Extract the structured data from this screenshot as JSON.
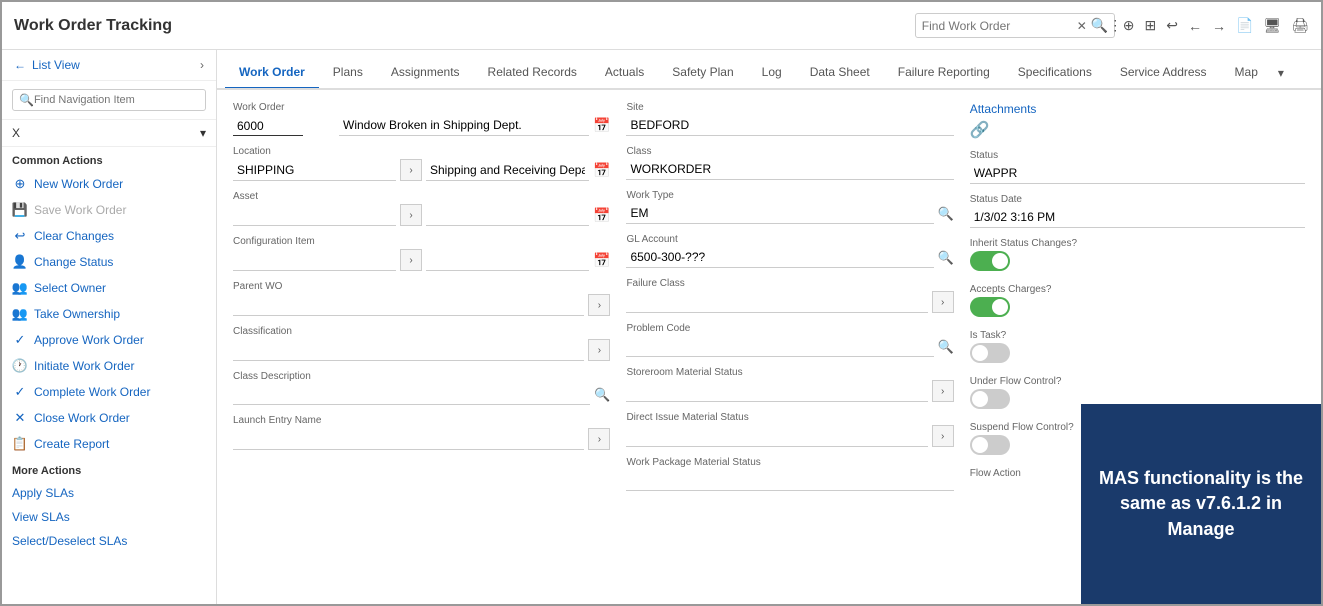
{
  "app": {
    "title": "Work Order Tracking",
    "search_placeholder": "Find Work Order"
  },
  "tabs": {
    "items": [
      {
        "label": "Work Order",
        "active": true
      },
      {
        "label": "Plans",
        "active": false
      },
      {
        "label": "Assignments",
        "active": false
      },
      {
        "label": "Related Records",
        "active": false
      },
      {
        "label": "Actuals",
        "active": false
      },
      {
        "label": "Safety Plan",
        "active": false
      },
      {
        "label": "Log",
        "active": false
      },
      {
        "label": "Data Sheet",
        "active": false
      },
      {
        "label": "Failure Reporting",
        "active": false
      },
      {
        "label": "Specifications",
        "active": false
      },
      {
        "label": "Service Address",
        "active": false
      },
      {
        "label": "Map",
        "active": false
      }
    ]
  },
  "sidebar": {
    "list_view": "List View",
    "search_placeholder": "Find Navigation Item",
    "dropdown_value": "X",
    "common_actions_label": "Common Actions",
    "actions": [
      {
        "label": "New Work Order",
        "icon": "+",
        "disabled": false,
        "name": "new-work-order"
      },
      {
        "label": "Save Work Order",
        "icon": "💾",
        "disabled": true,
        "name": "save-work-order"
      },
      {
        "label": "Clear Changes",
        "icon": "↩",
        "disabled": false,
        "name": "clear-changes"
      },
      {
        "label": "Change Status",
        "icon": "👤",
        "disabled": false,
        "name": "change-status"
      },
      {
        "label": "Select Owner",
        "icon": "👥",
        "disabled": false,
        "name": "select-owner"
      },
      {
        "label": "Take Ownership",
        "icon": "👥",
        "disabled": false,
        "name": "take-ownership"
      },
      {
        "label": "Approve Work Order",
        "icon": "✓",
        "disabled": false,
        "name": "approve-work-order"
      },
      {
        "label": "Initiate Work Order",
        "icon": "🕐",
        "disabled": false,
        "name": "initiate-work-order"
      },
      {
        "label": "Complete Work Order",
        "icon": "✓",
        "disabled": false,
        "name": "complete-work-order"
      },
      {
        "label": "Close Work Order",
        "icon": "✕",
        "disabled": false,
        "name": "close-work-order"
      },
      {
        "label": "Create Report",
        "icon": "📋",
        "disabled": false,
        "name": "create-report"
      }
    ],
    "more_actions_label": "More Actions",
    "more_actions": [
      {
        "label": "Apply SLAs",
        "name": "apply-slas"
      },
      {
        "label": "View SLAs",
        "name": "view-slas"
      },
      {
        "label": "Select/Deselect SLAs",
        "name": "select-deselect-slas"
      }
    ]
  },
  "form": {
    "work_order_label": "Work Order",
    "work_order_number": "6000",
    "work_order_desc": "Window Broken in Shipping Dept.",
    "location_label": "Location",
    "location_code": "SHIPPING",
    "location_desc": "Shipping and Receiving Department",
    "asset_label": "Asset",
    "asset_value": "",
    "config_item_label": "Configuration Item",
    "config_item_value": "",
    "parent_wo_label": "Parent WO",
    "parent_wo_value": "",
    "classification_label": "Classification",
    "classification_value": "",
    "class_desc_label": "Class Description",
    "class_desc_value": "",
    "launch_entry_label": "Launch Entry Name",
    "launch_entry_value": "",
    "site_label": "Site",
    "site_value": "BEDFORD",
    "class_label": "Class",
    "class_value": "WORKORDER",
    "work_type_label": "Work Type",
    "work_type_value": "EM",
    "gl_account_label": "GL Account",
    "gl_account_value": "6500-300-???",
    "failure_class_label": "Failure Class",
    "failure_class_value": "",
    "problem_code_label": "Problem Code",
    "problem_code_value": "",
    "storeroom_material_label": "Storeroom Material Status",
    "storeroom_material_value": "",
    "direct_issue_label": "Direct Issue Material Status",
    "direct_issue_value": "",
    "work_package_label": "Work Package Material Status",
    "work_package_value": "",
    "attachments_label": "Attachments",
    "status_label": "Status",
    "status_value": "WAPPR",
    "status_date_label": "Status Date",
    "status_date_value": "1/3/02 3:16 PM",
    "inherit_status_label": "Inherit Status Changes?",
    "inherit_status_on": true,
    "accepts_charges_label": "Accepts Charges?",
    "accepts_charges_on": true,
    "is_task_label": "Is Task?",
    "is_task_on": false,
    "under_flow_label": "Under Flow Control?",
    "under_flow_on": false,
    "suspend_flow_label": "Suspend Flow Control?",
    "suspend_flow_on": false,
    "flow_action_label": "Flow Action"
  },
  "mas_popup": {
    "text": "MAS functionality is the same as v7.6.1.2 in Manage"
  }
}
